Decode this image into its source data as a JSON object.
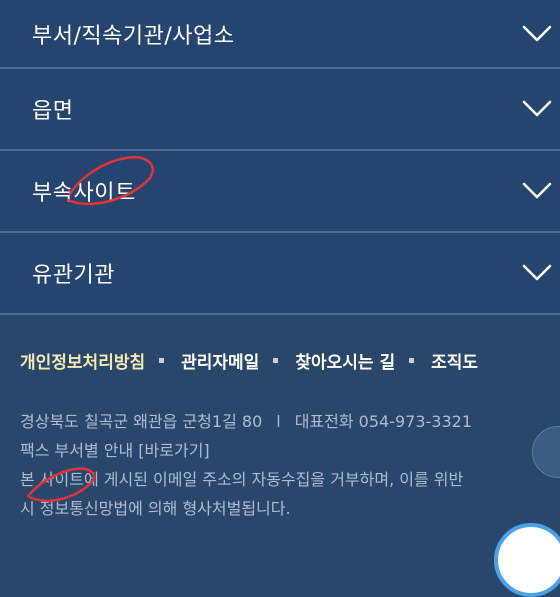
{
  "accordion": {
    "items": [
      {
        "label": "부서/직속기관/사업소"
      },
      {
        "label": "읍면"
      },
      {
        "label": "부속사이트"
      },
      {
        "label": "유관기관"
      }
    ]
  },
  "footer": {
    "links": [
      "개인정보처리방침",
      "관리자메일",
      "찾아오시는 길",
      "조직도"
    ],
    "address": "경상북도 칠곡군 왜관읍 군청1길 80",
    "separator": "l",
    "phone": "대표전화 054-973-3321",
    "fax": "팩스 부서별 안내 [바로가기]",
    "notice_line1": "본 사이트에 게시된 이메일 주소의 자동수집을 거부하며, 이를 위반",
    "notice_line2": "시 정보통신망법에 의해 형사처벌됩니다."
  },
  "colors": {
    "background": "#29476b",
    "accordion_bg": "#234570",
    "accent_link": "#f2eab0",
    "annotation": "#e53232"
  },
  "icons": {
    "accordion_toggle": "chevron-down-icon"
  }
}
